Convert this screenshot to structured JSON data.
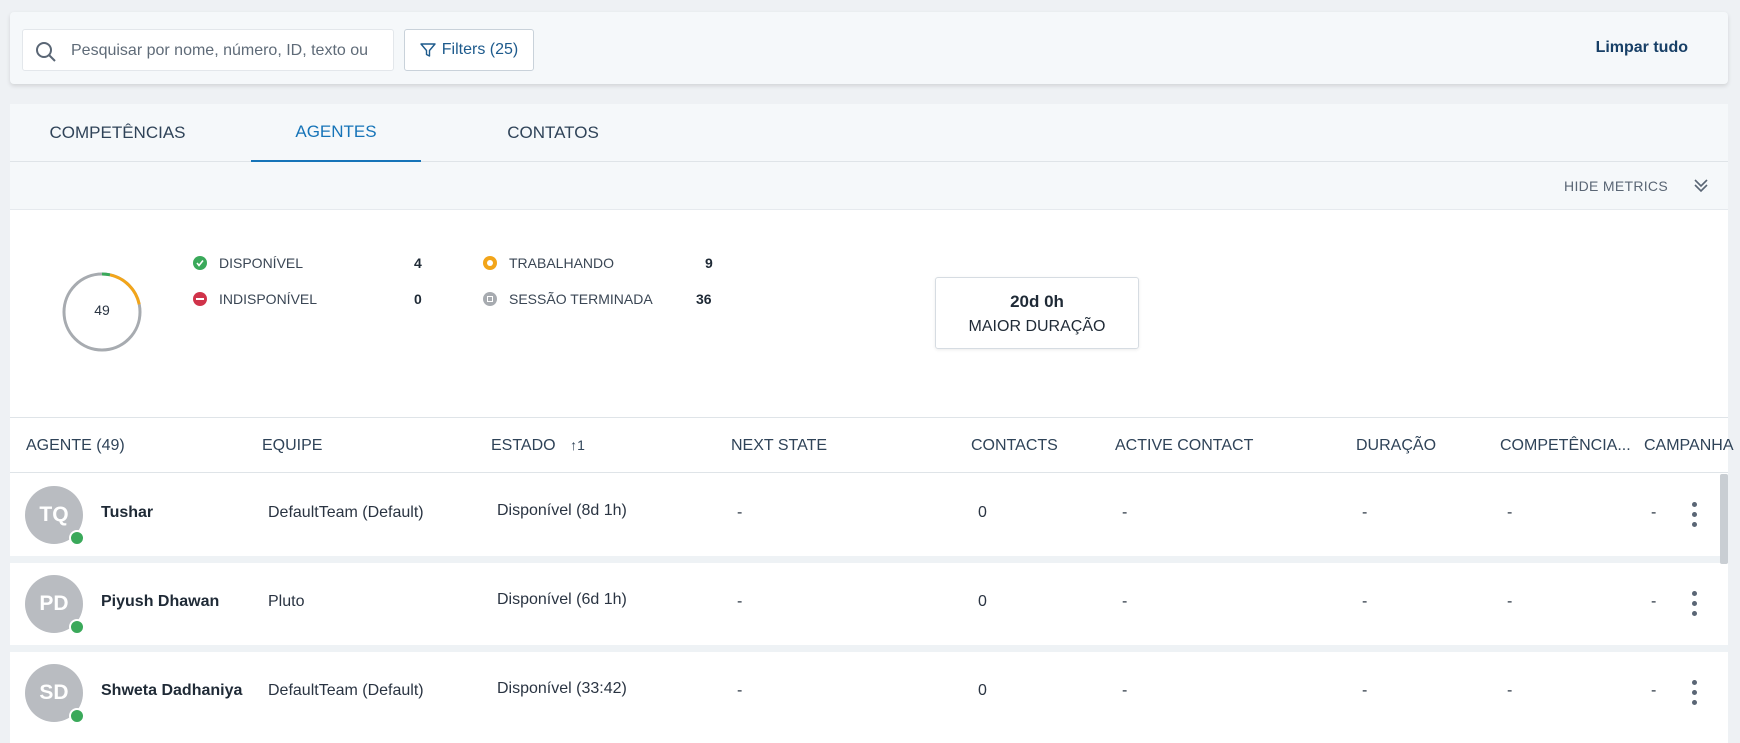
{
  "search": {
    "placeholder": "Pesquisar por nome, número, ID, texto ou",
    "value": ""
  },
  "filters_label": "Filters (25)",
  "clear_all_label": "Limpar tudo",
  "tabs": [
    {
      "label": "COMPETÊNCIAS",
      "active": false
    },
    {
      "label": "AGENTES",
      "active": true
    },
    {
      "label": "CONTATOS",
      "active": false
    }
  ],
  "hide_metrics_label": "HIDE METRICS",
  "metrics": {
    "total": "49",
    "available": {
      "label": "DISPONÍVEL",
      "value": "4",
      "color": "#3aa95a"
    },
    "unavailable": {
      "label": "INDISPONÍVEL",
      "value": "0",
      "color": "#d0334a"
    },
    "working": {
      "label": "TRABALHANDO",
      "value": "9",
      "color": "#f2a51a"
    },
    "logged_out": {
      "label": "SESSÃO TERMINADA",
      "value": "36",
      "color": "#a7abb0"
    },
    "longest_duration": {
      "value": "20d 0h",
      "label": "MAIOR DURAÇÃO"
    }
  },
  "table": {
    "headers": {
      "agent": "AGENTE (49)",
      "team": "EQUIPE",
      "state": "ESTADO",
      "sort_indicator": "↑1",
      "next_state": "NEXT STATE",
      "contacts": "CONTACTS",
      "active_contact": "ACTIVE CONTACT",
      "duration": "DURAÇÃO",
      "skills": "COMPETÊNCIA...",
      "campaign": "CAMPANHA"
    },
    "rows": [
      {
        "initials": "TQ",
        "name": "Tushar",
        "team": "DefaultTeam (Default)",
        "state": "Disponível (8d 1h)",
        "next_state": "-",
        "contacts": "0",
        "active_contact": "-",
        "duration": "-",
        "skills": "-",
        "campaign": "-"
      },
      {
        "initials": "PD",
        "name": "Piyush Dhawan",
        "team": "Pluto",
        "state": "Disponível (6d 1h)",
        "next_state": "-",
        "contacts": "0",
        "active_contact": "-",
        "duration": "-",
        "skills": "-",
        "campaign": "-"
      },
      {
        "initials": "SD",
        "name": "Shweta Dadhaniya",
        "team": "DefaultTeam (Default)",
        "state": "Disponível (33:42)",
        "next_state": "-",
        "contacts": "0",
        "active_contact": "-",
        "duration": "-",
        "skills": "-",
        "campaign": "-"
      }
    ]
  }
}
